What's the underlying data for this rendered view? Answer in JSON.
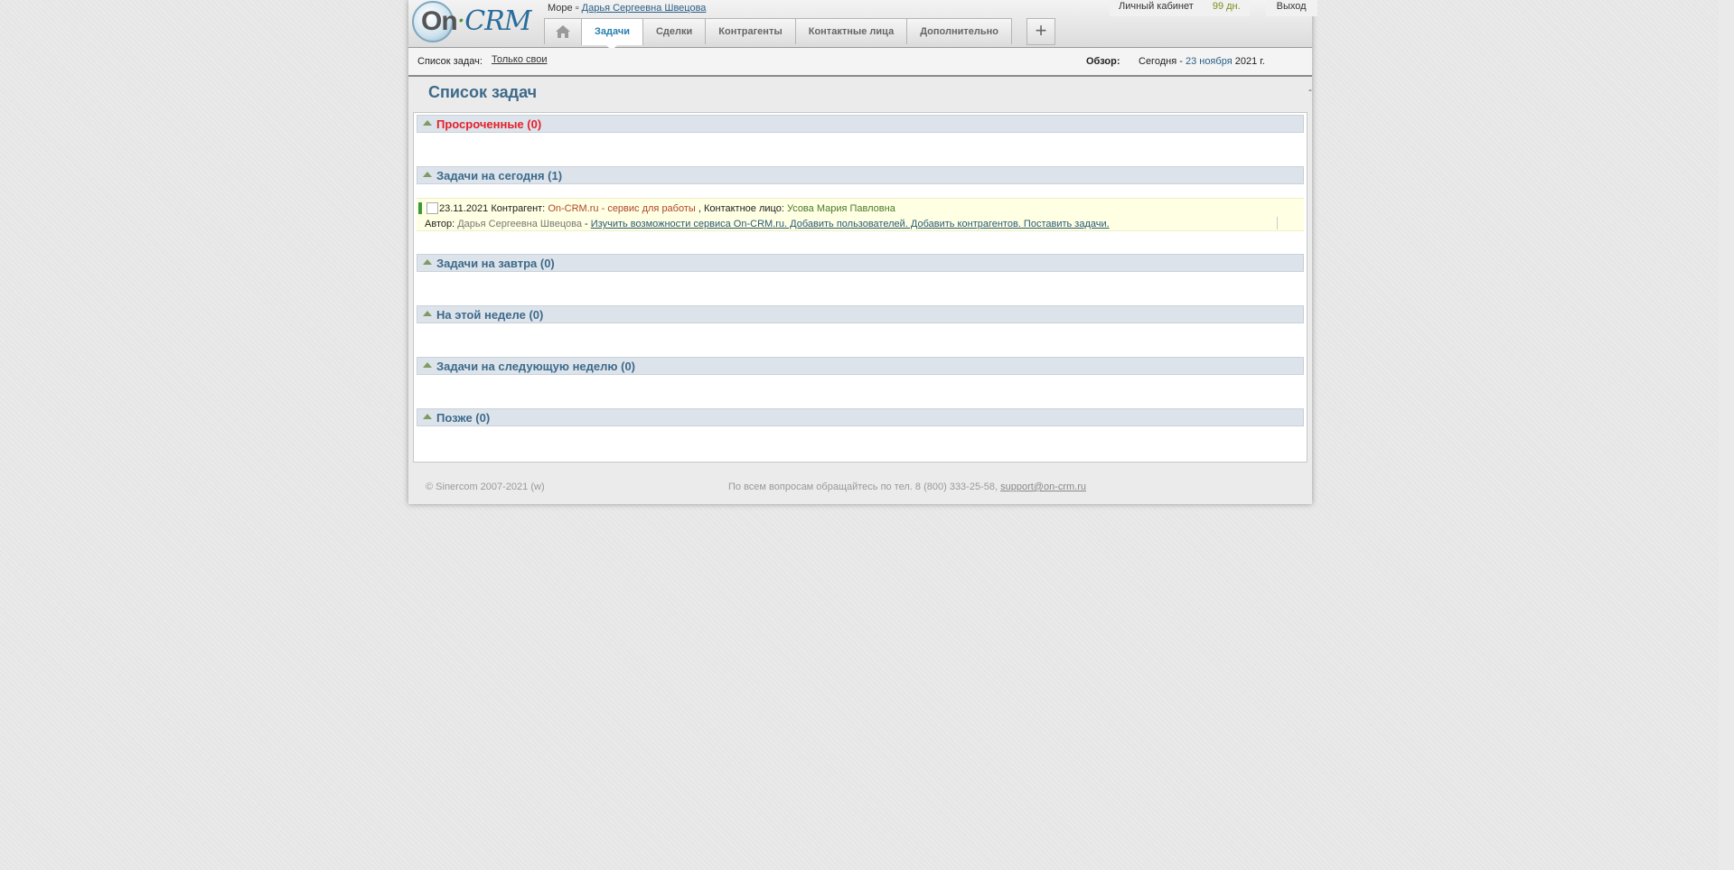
{
  "header": {
    "logo": "On·CRM",
    "breadcrumb": {
      "company": "Море",
      "separator": "▫",
      "user": "Дарья Сергеевна Швецова"
    },
    "nav": {
      "home_icon": "home-icon",
      "tabs": [
        "Задачи",
        "Сделки",
        "Контрагенты",
        "Контактные лица",
        "Дополнительно"
      ],
      "active": "Задачи"
    },
    "add_label": "+",
    "cabinet_label": "Личный кабинет",
    "days": "99 дн.",
    "logout": "Выход"
  },
  "subbar": {
    "list_label": "Список задач:",
    "filter": "Только свои",
    "overview_label": "Обзор:",
    "today_prefix": "Сегодня -",
    "today_date": "23 ноября",
    "today_year": "2021 г."
  },
  "page_title": "Список задач",
  "title_dash": "-",
  "sections": [
    {
      "title": "Просроченные (0)"
    },
    {
      "title": "Задачи на сегодня (1)"
    },
    {
      "title": "Задачи на завтра (0)"
    },
    {
      "title": "На этой неделе (0)"
    },
    {
      "title": "Задачи на следующую неделю (0)"
    },
    {
      "title": "Позже (0)"
    }
  ],
  "task": {
    "date": "23.11.2021",
    "contractor_label": "Контрагент:",
    "contractor": "On-CRM.ru - сервис для работы",
    "contact_label": ", Контактное лицо:",
    "contact": "Усова Мария Павловна",
    "author_label": "Автор:",
    "author": "Дарья Сергеевна Швецова",
    "dash": "-",
    "description": "Изучить возможности сервиса On-CRM.ru. Добавить пользователей. Добавить контрагентов. Поставить задачи."
  },
  "footer": {
    "copyright": "© Sinercom 2007-2021 (w)",
    "contact_text": "По всем вопросам обращайтесь по тел. 8 (800) 333-25-58,",
    "email": "support@on-crm.ru"
  },
  "colors": {
    "accent": "#2a7fb0",
    "overdue": "#e4202a",
    "section_bg": "#dde3ea",
    "task_bg": "#ffffe3"
  }
}
